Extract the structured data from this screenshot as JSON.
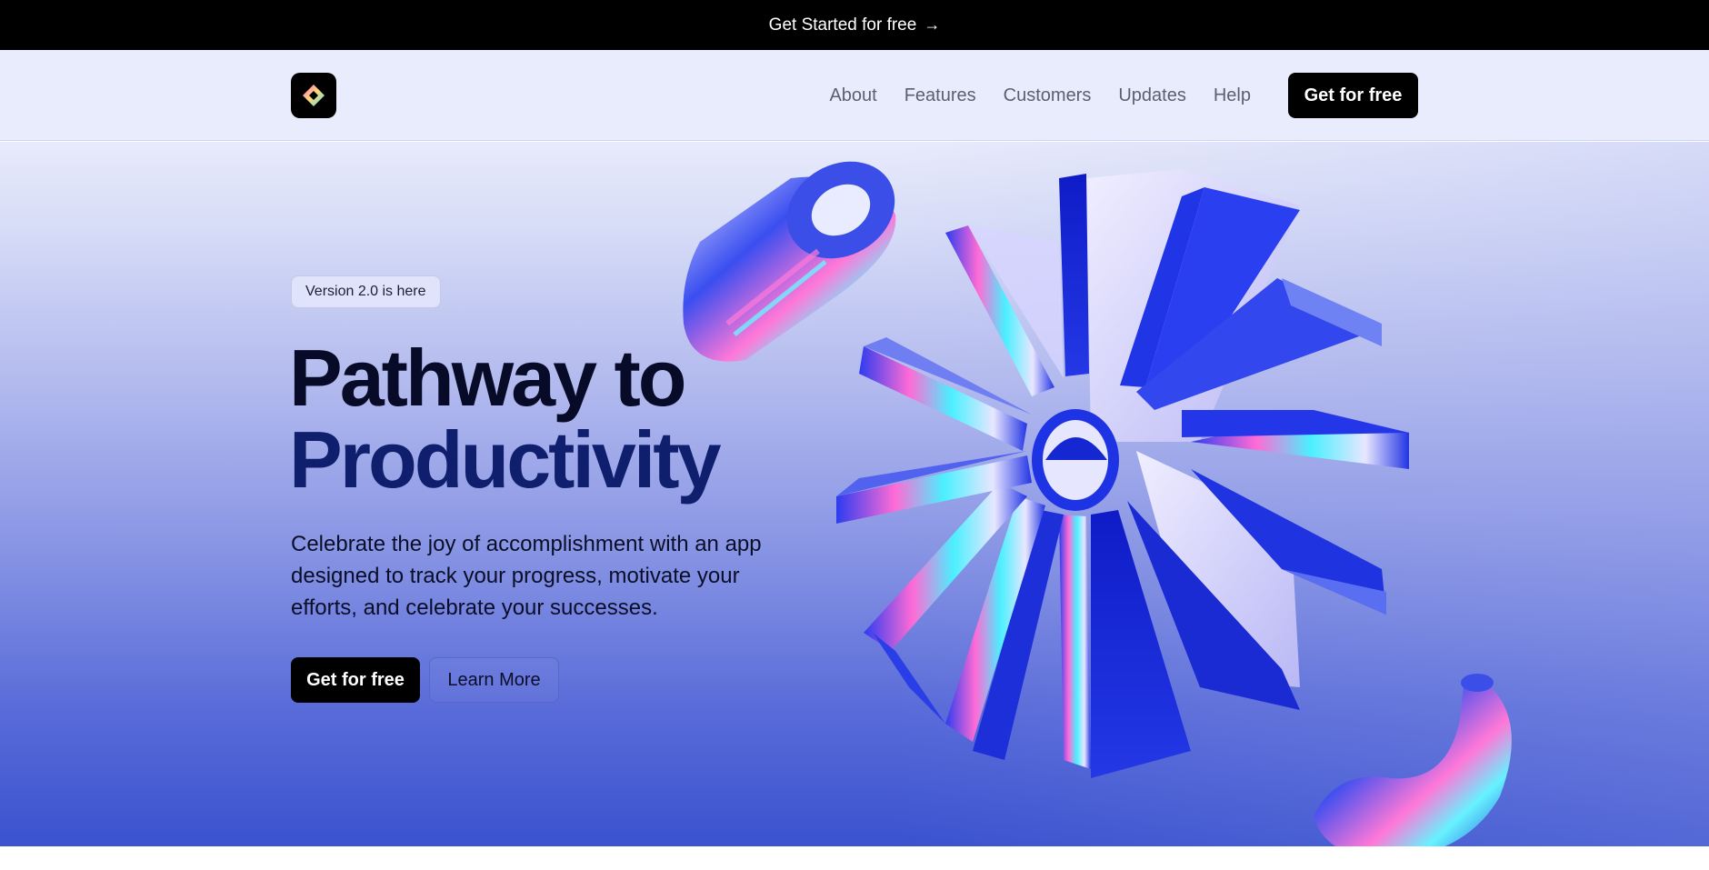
{
  "announcement": {
    "text": "Get Started for free",
    "arrow_icon": "→"
  },
  "header": {
    "logo_icon": "diamond-logo",
    "nav": [
      {
        "label": "About"
      },
      {
        "label": "Features"
      },
      {
        "label": "Customers"
      },
      {
        "label": "Updates"
      },
      {
        "label": "Help"
      }
    ],
    "cta_label": "Get for free"
  },
  "hero": {
    "badge": "Version 2.0 is here",
    "title_line1": "Pathway to",
    "title_line2": "Productivity",
    "subtitle": "Celebrate the joy of accomplishment with an app designed to track your progress, motivate your efforts, and celebrate your successes.",
    "primary_cta": "Get for free",
    "secondary_cta": "Learn More"
  },
  "colors": {
    "topbar": "#000000",
    "header_bg": "#e9ecfd",
    "hero_top": "#e8ebfb",
    "hero_bottom": "#3a52cf",
    "accent_blue": "#1d33d9"
  }
}
